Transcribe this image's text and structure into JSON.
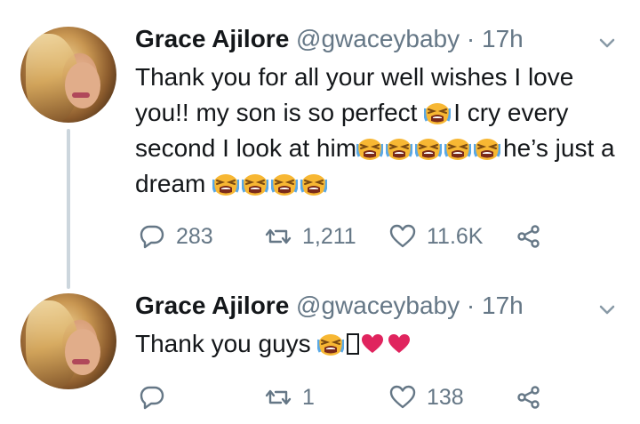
{
  "tweets": [
    {
      "display_name": "Grace Ajilore",
      "handle": "@gwaceybaby",
      "separator": "·",
      "time": "17h",
      "text": {
        "part1": "Thank you for all your well wishes I love you!! my son is so perfect ",
        "part2": "I  cry every second I look at him",
        "part3": "he’s just a dream "
      },
      "emoji_names": [
        "crying-face-emoji",
        "crying-face-emoji",
        "crying-face-emoji",
        "crying-face-emoji",
        "crying-face-emoji",
        "crying-face-emoji",
        "crying-face-emoji",
        "crying-face-emoji",
        "crying-face-emoji",
        "crying-face-emoji"
      ],
      "stats": {
        "replies": "283",
        "retweets": "1,211",
        "likes": "11.6K"
      }
    },
    {
      "display_name": "Grace Ajilore",
      "handle": "@gwaceybaby",
      "separator": "·",
      "time": "17h",
      "text": {
        "part1": "Thank you guys ",
        "missing_glyph": "?"
      },
      "emoji_names": [
        "crying-face-emoji",
        "missing-glyph",
        "red-heart-emoji",
        "red-heart-emoji"
      ],
      "stats": {
        "replies": "",
        "retweets": "1",
        "likes": "138"
      }
    }
  ],
  "colors": {
    "primary_text": "#14171a",
    "secondary_text": "#657786",
    "thread_line": "#ccd6dd",
    "emoji_face": "#f7b733",
    "heart": "#e0245e"
  }
}
